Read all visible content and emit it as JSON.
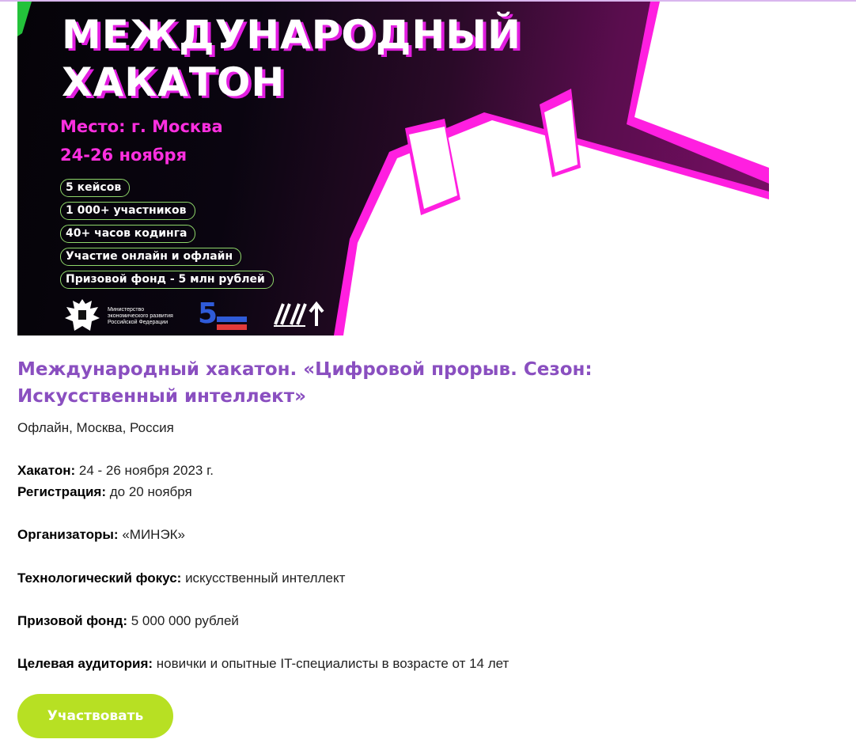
{
  "banner": {
    "title_line1": "МЕЖДУНАРОДНЫЙ",
    "title_line2": "ХАКАТОН",
    "place": "Место: г. Москва",
    "dates": "24-26 ноября",
    "pills": [
      "5 кейсов",
      "1 000+ участников",
      "40+ часов кодинга",
      "Участие онлайн и офлайн",
      "Призовой фонд - 5 млн рублей"
    ],
    "logo_minek_line1": "Министерство",
    "logo_minek_line2": "экономического развития",
    "logo_minek_line3": "Российской Федерации"
  },
  "event": {
    "title": "Международный хакатон. «Цифровой прорыв. Сезон: Искусственный интеллект»",
    "format": "Офлайн, Москва, Россия",
    "hackathon_label": "Хакатон:",
    "hackathon_value": "24 - 26 ноября 2023 г.",
    "registration_label": "Регистрация:",
    "registration_value": "до 20 ноября",
    "organizers_label": "Организаторы:",
    "organizers_value": "«МИНЭК»",
    "focus_label": "Технологический фокус:",
    "focus_value": "искусственный интеллект",
    "prize_label": "Призовой фонд:",
    "prize_value": "5 000 000 рублей",
    "audience_label": "Целевая аудитория:",
    "audience_value": "новички и опытные IT-специалисты в возрасте от 14 лет",
    "cta_label": "Участвовать"
  },
  "colors": {
    "title_purple": "#8a4fc0",
    "cta_green": "#b7e023",
    "banner_magenta": "#ff2fe0"
  }
}
